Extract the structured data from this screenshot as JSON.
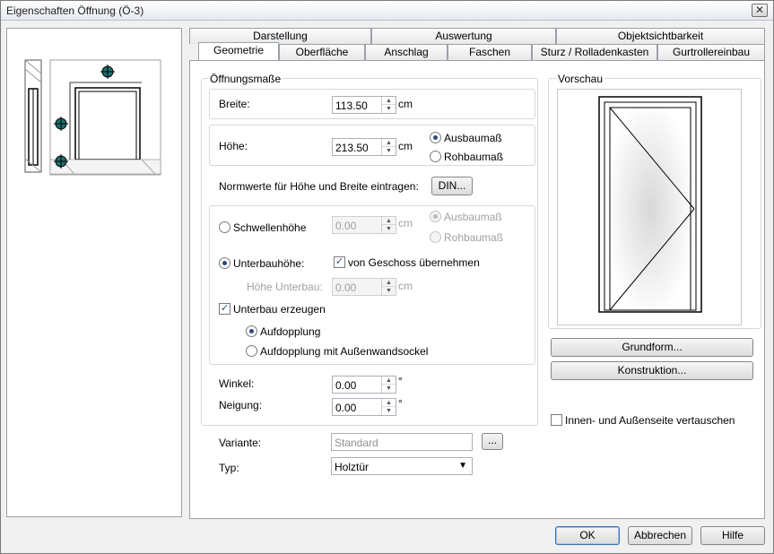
{
  "window": {
    "title": "Eigenschaften Öffnung (Ö-3)",
    "close_glyph": "✕"
  },
  "tabs_top": [
    "Darstellung",
    "Auswertung",
    "Objektsichtbarkeit"
  ],
  "tabs_bottom": [
    "Geometrie",
    "Oberfläche",
    "Anschlag",
    "Faschen",
    "Sturz / Rolladenkasten",
    "Gurtrollereinbau"
  ],
  "active_tab": "Geometrie",
  "groups": {
    "oeffnungsmasse": "Öffnungsmaße",
    "vorschau": "Vorschau"
  },
  "breite": {
    "label": "Breite:",
    "value": "113.50",
    "unit": "cm"
  },
  "hoehe": {
    "label": "Höhe:",
    "value": "213.50",
    "unit": "cm",
    "option1": "Ausbaumaß",
    "option2": "Rohbaumaß"
  },
  "normwerte": {
    "label": "Normwerte für Höhe und Breite eintragen:",
    "button": "DIN..."
  },
  "schwelle": {
    "label": "Schwellenhöhe",
    "value": "0.00",
    "unit": "cm",
    "option1": "Ausbaumaß",
    "option2": "Rohbaumaß"
  },
  "unterbau": {
    "label": "Unterbauhöhe:",
    "check_label": "von Geschoss übernehmen",
    "hoehe_label": "Höhe Unterbau:",
    "hoehe_value": "0.00",
    "unit": "cm",
    "erzeugen_label": "Unterbau erzeugen",
    "opt1": "Aufdopplung",
    "opt2": "Aufdopplung mit Außenwandsockel"
  },
  "winkel": {
    "label": "Winkel:",
    "value": "0.00",
    "unit": "°"
  },
  "neigung": {
    "label": "Neigung:",
    "value": "0.00",
    "unit": "°"
  },
  "variante": {
    "label": "Variante:",
    "value": "Standard",
    "button": "..."
  },
  "typ": {
    "label": "Typ:",
    "value": "Holztür",
    "arrow": "▼"
  },
  "side_buttons": {
    "grundform": "Grundform...",
    "konstruktion": "Konstruktion..."
  },
  "swap": {
    "label": "Innen- und Außenseite vertauschen"
  },
  "footer": {
    "ok": "OK",
    "cancel": "Abbrechen",
    "help": "Hilfe"
  },
  "spin_glyphs": {
    "up": "▲",
    "down": "▼"
  },
  "check_glyph": "✓"
}
